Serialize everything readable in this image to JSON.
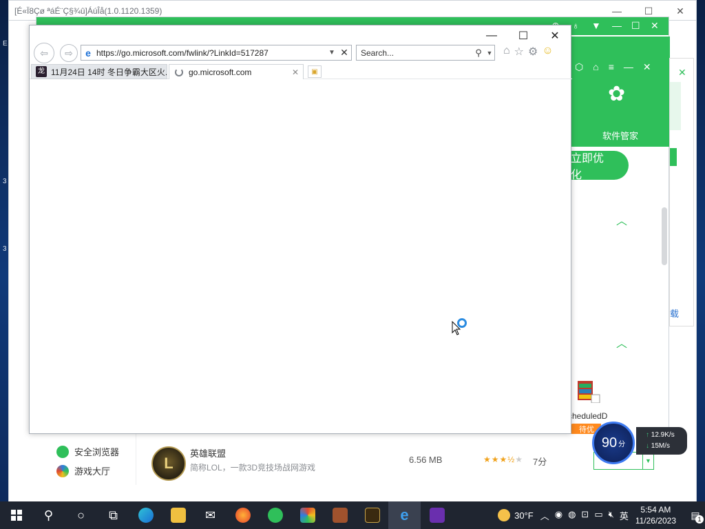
{
  "outer_window": {
    "title": "[É«Ï8Çø ªáÉ¨Ç§¾û]ÁúÎå(1.0.1120.1359)",
    "controls": [
      "—",
      "☐",
      "✕"
    ]
  },
  "software_manager": {
    "side_label": "软件管家",
    "optimize_label": "立即优化",
    "scheduled_label": "cheduledD",
    "pending_label": "待优",
    "nav": [
      {
        "label": "安全浏览器",
        "icon": "green-browser-icon"
      },
      {
        "label": "游戏大厅",
        "icon": "game-hall-icon"
      }
    ],
    "row": {
      "name": "英雄联盟",
      "desc": "简称LOL，一款3D竞技场战网游戏",
      "size": "6.56 MB",
      "score": "7分",
      "rating": 3.5
    },
    "right_panel_link": "载"
  },
  "browser": {
    "back_icon": "back-arrow-icon",
    "forward_icon": "forward-arrow-icon",
    "url": "https://go.microsoft.com/fwlink/?LinkId=517287",
    "search_placeholder": "Search...",
    "tabs": [
      {
        "title": "11月24日 14时 冬日争霸大区火..."
      },
      {
        "title": "go.microsoft.com"
      }
    ],
    "controls": [
      "—",
      "☐",
      "✕"
    ]
  },
  "speed_widget": {
    "score": "90",
    "unit": "分",
    "up_rate": "12.9K/s",
    "down_rate": "15M/s"
  },
  "taskbar": {
    "weather_temp": "30°F",
    "time": "5:54 AM",
    "date": "11/26/2023",
    "notification_count": "1"
  },
  "colors": {
    "accent_green": "#2fbf5a",
    "orange": "#ff8a1e",
    "taskbar": "#1f2530"
  }
}
